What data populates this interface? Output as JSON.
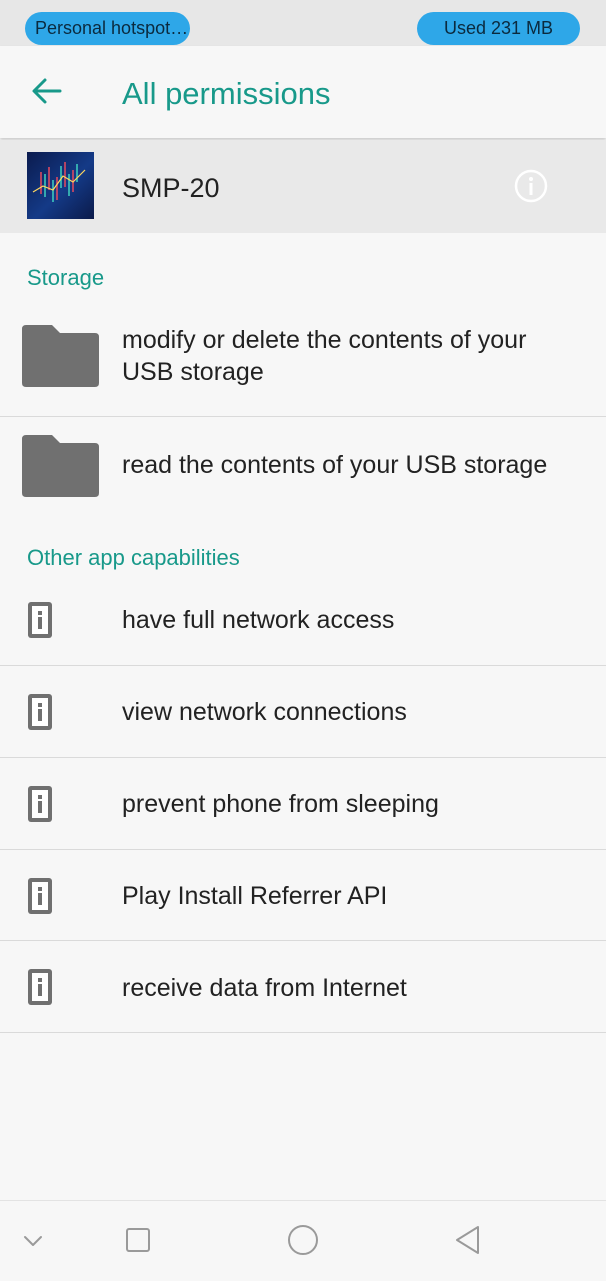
{
  "status_bar": {
    "hotspot_label": "Personal hotspot…",
    "data_usage": "Used  231 MB"
  },
  "app_bar": {
    "back_icon": "arrow-back-icon",
    "title": "All permissions"
  },
  "app": {
    "name": "SMP-20",
    "info_icon": "info-circle-icon"
  },
  "sections": [
    {
      "header": "Storage",
      "items": [
        {
          "label": "modify or delete the contents of your USB storage",
          "icon": "folder-icon"
        },
        {
          "label": "read the contents of your USB storage",
          "icon": "folder-icon"
        }
      ]
    },
    {
      "header": "Other app capabilities",
      "items": [
        {
          "label": "have full network access",
          "icon": "info-icon"
        },
        {
          "label": "view network connections",
          "icon": "info-icon"
        },
        {
          "label": "prevent phone from sleeping",
          "icon": "info-icon"
        },
        {
          "label": "Play Install Referrer API",
          "icon": "info-icon"
        },
        {
          "label": "receive data from Internet",
          "icon": "info-icon"
        }
      ]
    }
  ],
  "nav_bar": [
    "chevron-down-icon",
    "recents-square-icon",
    "home-circle-icon",
    "back-triangle-icon"
  ],
  "colors": {
    "accent": "#18998a",
    "status_pill": "#2ea7e8",
    "icon_gray": "#707070"
  }
}
